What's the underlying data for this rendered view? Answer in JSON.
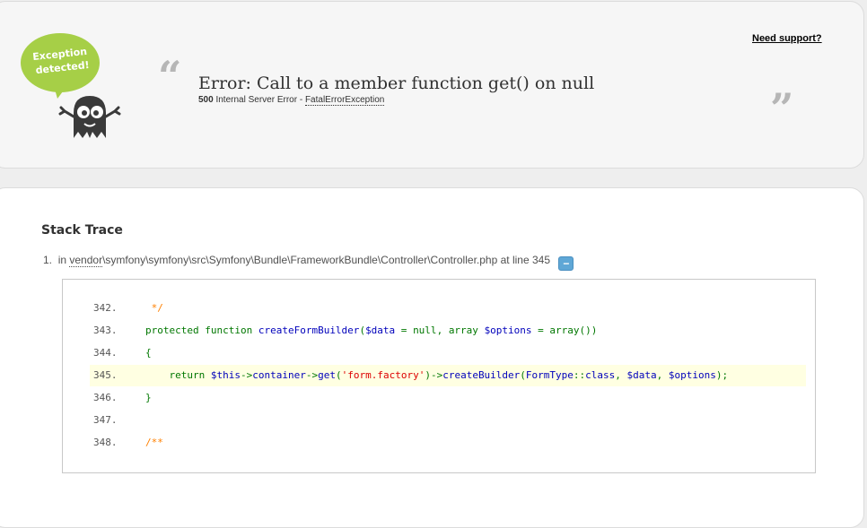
{
  "header": {
    "mascot_bubble_line1": "Exception",
    "mascot_bubble_line2": "detected!",
    "support_link": "Need support?",
    "error_message": "Error: Call to a member function get() on null",
    "status_code": "500",
    "status_text": "Internal Server Error -",
    "exception_class": "FatalErrorException",
    "quote_open": "“",
    "quote_close": "”"
  },
  "trace": {
    "title": "Stack Trace",
    "entry": {
      "index": "1.",
      "prefix": "in",
      "vendor": "vendor",
      "path": "\\symfony\\symfony\\src\\Symfony\\Bundle\\FrameworkBundle\\Controller\\Controller.php",
      "suffix": "at line 345",
      "toggle_label": "−"
    },
    "code_lines": [
      {
        "number": "342.",
        "text": " */"
      },
      {
        "number": "343.",
        "text": "protected function createFormBuilder($data = null, array $options = array())"
      },
      {
        "number": "344.",
        "text": "{"
      },
      {
        "number": "345.",
        "text": "    return $this->container->get('form.factory')->createBuilder(FormType::class, $data, $options);"
      },
      {
        "number": "346.",
        "text": "}"
      },
      {
        "number": "347.",
        "text": ""
      },
      {
        "number": "348.",
        "text": "/**"
      }
    ]
  },
  "colors": {
    "mascot_green": "#a6cf47",
    "mascot_dark": "#3a3a3a",
    "highlight": "#ffffe2",
    "toggle_blue": "#5fa7d6"
  }
}
